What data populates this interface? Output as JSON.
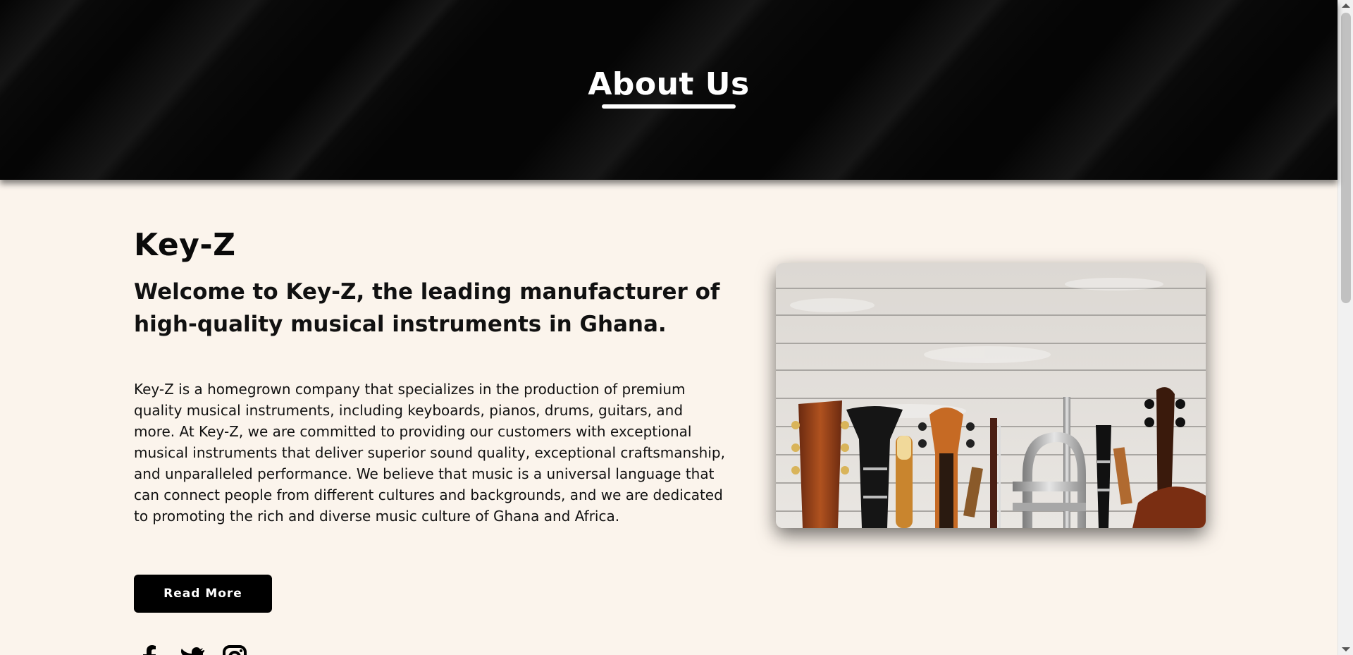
{
  "hero": {
    "title": "About Us"
  },
  "about": {
    "brand": "Key-Z",
    "welcome": "Welcome to Key-Z, the leading manufacturer of high-quality musical instruments in Ghana.",
    "body": "Key-Z is a homegrown company that specializes in the production of premium quality musical instruments, including keyboards, pianos, drums, guitars, and more. At Key-Z, we are committed to providing our customers with exceptional musical instruments that deliver superior sound quality, exceptional craftsmanship, and unparalleled performance. We believe that music is a universal language that can connect people from different cultures and backgrounds, and we are dedicated to promoting the rich and diverse music culture of Ghana and Africa.",
    "read_more_label": "Read More"
  },
  "socials": [
    "facebook-icon",
    "twitter-icon",
    "instagram-icon"
  ],
  "colors": {
    "background": "#fbf4ec",
    "hero": "#050505",
    "button": "#000000",
    "text": "#0b0b0b"
  }
}
